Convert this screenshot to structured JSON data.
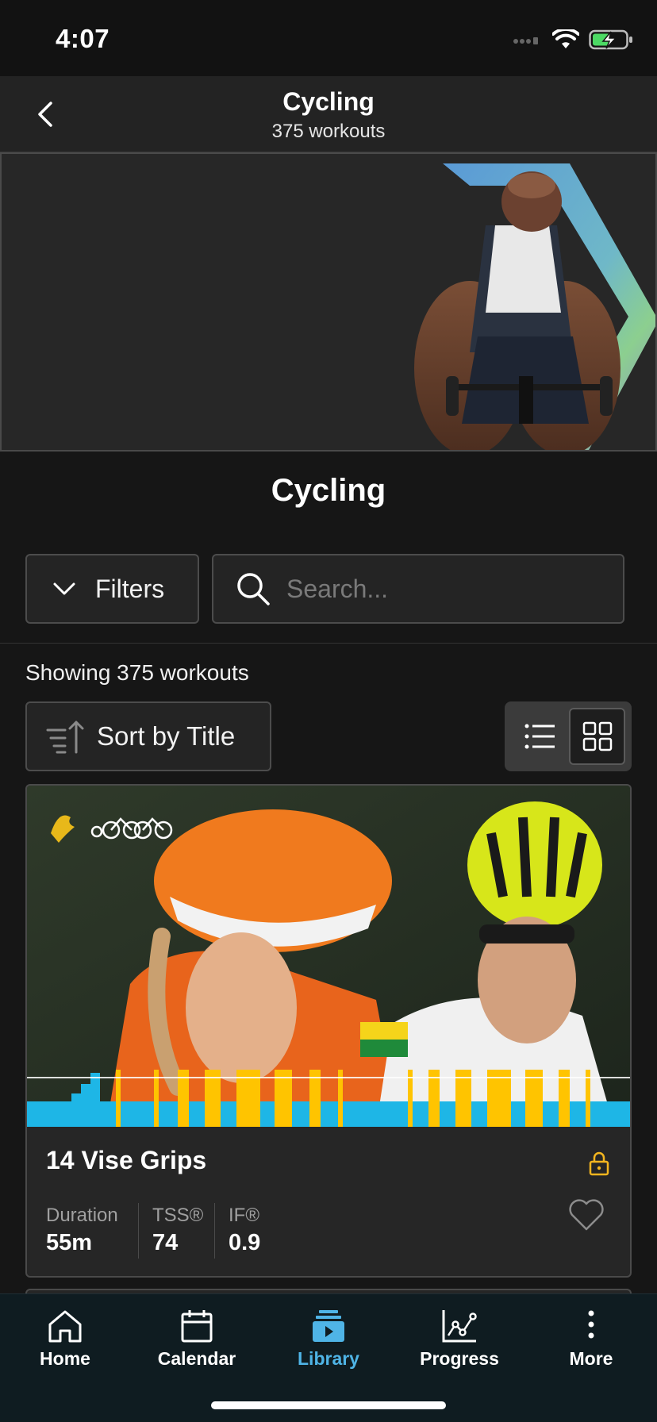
{
  "status_bar": {
    "time": "4:07"
  },
  "header": {
    "title": "Cycling",
    "subtitle": "375 workouts"
  },
  "section": {
    "title": "Cycling"
  },
  "filters": {
    "label": "Filters"
  },
  "search": {
    "placeholder": "Search...",
    "value": ""
  },
  "results": {
    "showing_text": "Showing 375 workouts"
  },
  "sort": {
    "label": "Sort by Title"
  },
  "workout_card": {
    "title": "14 Vise Grips",
    "locked": true,
    "favorited": false,
    "stats": [
      {
        "label": "Duration",
        "value": "55m"
      },
      {
        "label": "TSS®",
        "value": "74"
      },
      {
        "label": "IF®",
        "value": "0.9"
      }
    ]
  },
  "tab_bar": {
    "items": [
      {
        "label": "Home",
        "icon": "home-icon"
      },
      {
        "label": "Calendar",
        "icon": "calendar-icon"
      },
      {
        "label": "Library",
        "icon": "library-icon",
        "active": true
      },
      {
        "label": "Progress",
        "icon": "progress-icon"
      },
      {
        "label": "More",
        "icon": "more-icon"
      }
    ]
  },
  "colors": {
    "accent_blue": "#4fb4e6",
    "lock_gold": "#f3b51f",
    "profile_blue": "#1eb6e6",
    "profile_yellow": "#ffc400"
  }
}
